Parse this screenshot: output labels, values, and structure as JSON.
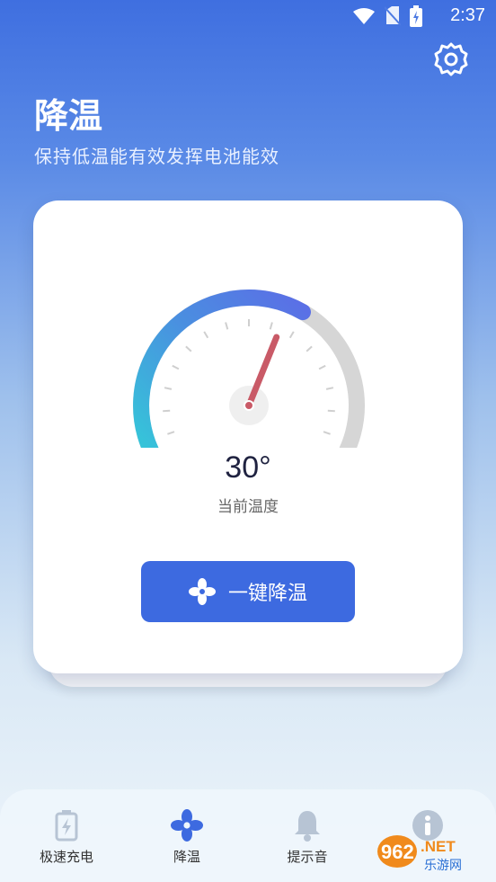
{
  "status": {
    "time": "2:37"
  },
  "header": {
    "title": "降温",
    "subtitle": "保持低温能有效发挥电池能效"
  },
  "gauge": {
    "temperature": "30°",
    "label": "当前温度",
    "value": 30,
    "progress_fraction": 0.62
  },
  "action": {
    "cool_button_label": "一键降温"
  },
  "nav": {
    "items": [
      {
        "label": "极速充电",
        "icon": "battery-charge-icon"
      },
      {
        "label": "降温",
        "icon": "fan-icon"
      },
      {
        "label": "提示音",
        "icon": "bell-icon"
      },
      {
        "label": "",
        "icon": "info-icon"
      }
    ]
  },
  "watermark": {
    "text": "962.NET 乐游网"
  },
  "colors": {
    "accent": "#3d6ae0",
    "needle": "#c95a67",
    "gauge_start": "#33cbd8",
    "gauge_end": "#5b6ee6",
    "track": "#d6d6d6"
  }
}
